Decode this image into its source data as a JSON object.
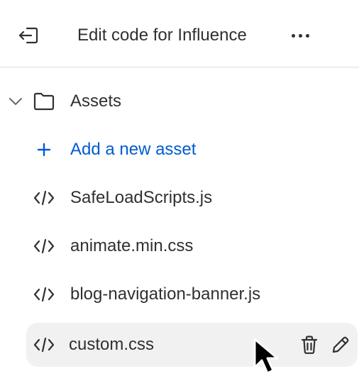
{
  "header": {
    "title": "Edit code for Influence",
    "exit_icon": "exit-icon",
    "more_icon": "more-horizontal-icon"
  },
  "tree": {
    "folder": {
      "label": "Assets",
      "chevron_icon": "chevron-down-icon",
      "folder_icon": "folder-icon"
    },
    "add_asset": {
      "label": "Add a new asset",
      "icon": "plus-icon",
      "color": "#005bd3"
    },
    "files": [
      {
        "label": "SafeLoadScripts.js",
        "icon": "code-icon"
      },
      {
        "label": "animate.min.css",
        "icon": "code-icon"
      },
      {
        "label": "blog-navigation-banner.js",
        "icon": "code-icon"
      },
      {
        "label": "custom.css",
        "icon": "code-icon",
        "hovered": true,
        "actions": [
          "delete-icon",
          "edit-icon"
        ]
      }
    ]
  },
  "colors": {
    "text": "#303030",
    "link": "#005bd3",
    "hover_bg": "#f1f1f1",
    "divider": "#e3e3e3"
  }
}
